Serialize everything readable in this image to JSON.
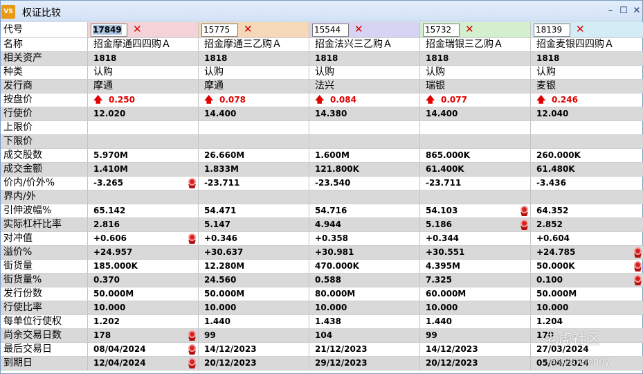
{
  "window": {
    "app_icon": "VS",
    "title": "权证比较",
    "controls": {
      "minimize": "–",
      "maximize": "☐",
      "close": "✕"
    }
  },
  "columns": [
    {
      "code": "17849",
      "color": "#f3d3d8",
      "selected": true
    },
    {
      "code": "15775",
      "color": "#f4d8b8"
    },
    {
      "code": "15544",
      "color": "#d6d4f2"
    },
    {
      "code": "15732",
      "color": "#d4efce"
    },
    {
      "code": "18139",
      "color": "#d3ecf6"
    }
  ],
  "labels": {
    "code": "代号",
    "name": "名称",
    "underlying": "相关资产",
    "type": "种类",
    "issuer": "发行商",
    "bid": "按盘价",
    "strike": "行使价",
    "upper": "上限价",
    "lower": "下限价",
    "volume": "成交股数",
    "turnover": "成交金额",
    "moneyness": "价内/价外%",
    "boundary": "界内/外",
    "iv": "引伸波幅%",
    "gearing": "实际杠杆比率",
    "delta": "对冲值",
    "premium": "溢价%",
    "outstanding": "街货量",
    "outstanding_pct": "街货量%",
    "issue_size": "发行份数",
    "ratio": "行使比率",
    "entitlement": "每单位行使权",
    "days_left": "尚余交易日数",
    "last_trade": "最后交易日",
    "expiry": "到期日"
  },
  "data": [
    {
      "name": "招金摩通四四购Ａ",
      "underlying": "1818",
      "type": "认购",
      "issuer": "摩通",
      "bid": "0.250",
      "strike": "12.020",
      "upper": "",
      "lower": "",
      "volume": "5.970M",
      "turnover": "1.410M",
      "moneyness": "-3.265",
      "boundary": "",
      "iv": "65.142",
      "gearing": "2.816",
      "delta": "+0.606",
      "premium": "+24.957",
      "outstanding": "185.000K",
      "outstanding_pct": "0.370",
      "issue_size": "50.000M",
      "ratio": "10.000",
      "entitlement": "1.202",
      "days_left": "178",
      "last_trade": "08/04/2024",
      "expiry": "12/04/2024"
    },
    {
      "name": "招金摩通三乙购Ａ",
      "underlying": "1818",
      "type": "认购",
      "issuer": "摩通",
      "bid": "0.078",
      "strike": "14.400",
      "upper": "",
      "lower": "",
      "volume": "26.660M",
      "turnover": "1.833M",
      "moneyness": "-23.711",
      "boundary": "",
      "iv": "54.471",
      "gearing": "5.147",
      "delta": "+0.346",
      "premium": "+30.637",
      "outstanding": "12.280M",
      "outstanding_pct": "24.560",
      "issue_size": "50.000M",
      "ratio": "10.000",
      "entitlement": "1.440",
      "days_left": "99",
      "last_trade": "14/12/2023",
      "expiry": "20/12/2023"
    },
    {
      "name": "招金法兴三乙购Ａ",
      "underlying": "1818",
      "type": "认购",
      "issuer": "法兴",
      "bid": "0.084",
      "strike": "14.380",
      "upper": "",
      "lower": "",
      "volume": "1.600M",
      "turnover": "121.800K",
      "moneyness": "-23.540",
      "boundary": "",
      "iv": "54.716",
      "gearing": "4.944",
      "delta": "+0.358",
      "premium": "+30.981",
      "outstanding": "470.000K",
      "outstanding_pct": "0.588",
      "issue_size": "80.000M",
      "ratio": "10.000",
      "entitlement": "1.438",
      "days_left": "104",
      "last_trade": "21/12/2023",
      "expiry": "29/12/2023"
    },
    {
      "name": "招金瑞银三乙购Ａ",
      "underlying": "1818",
      "type": "认购",
      "issuer": "瑞银",
      "bid": "0.077",
      "strike": "14.400",
      "upper": "",
      "lower": "",
      "volume": "865.000K",
      "turnover": "61.400K",
      "moneyness": "-23.711",
      "boundary": "",
      "iv": "54.103",
      "gearing": "5.186",
      "delta": "+0.344",
      "premium": "+30.551",
      "outstanding": "4.395M",
      "outstanding_pct": "7.325",
      "issue_size": "60.000M",
      "ratio": "10.000",
      "entitlement": "1.440",
      "days_left": "99",
      "last_trade": "14/12/2023",
      "expiry": "20/12/2023"
    },
    {
      "name": "招金麦银四四购Ａ",
      "underlying": "1818",
      "type": "认购",
      "issuer": "麦银",
      "bid": "0.246",
      "strike": "12.040",
      "upper": "",
      "lower": "",
      "volume": "260.000K",
      "turnover": "61.480K",
      "moneyness": "-3.436",
      "boundary": "",
      "iv": "64.352",
      "gearing": "2.852",
      "delta": "+0.604",
      "premium": "+24.785",
      "outstanding": "50.000K",
      "outstanding_pct": "0.100",
      "issue_size": "50.000M",
      "ratio": "10.000",
      "entitlement": "1.204",
      "days_left": "170",
      "last_trade": "27/03/2024",
      "expiry": "05/04/2024"
    }
  ],
  "best_marks": {
    "moneyness": [
      0
    ],
    "iv": [
      3
    ],
    "gearing": [
      3
    ],
    "delta": [
      0
    ],
    "premium": [
      4
    ],
    "outstanding": [
      4
    ],
    "outstanding_pct": [
      4
    ],
    "days_left": [
      0
    ],
    "last_trade": [
      0
    ],
    "expiry": [
      0
    ]
  },
  "icons": {
    "up_arrow": "up-arrow-icon",
    "medal": "medal-icon",
    "remove": "remove-icon"
  },
  "watermark": {
    "logo": "老虎社区",
    "user": "@谈股论Jenny"
  }
}
